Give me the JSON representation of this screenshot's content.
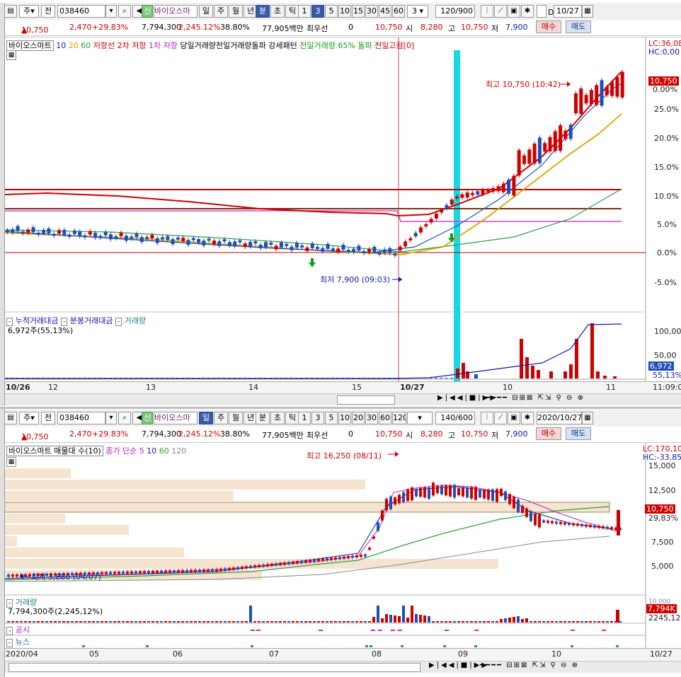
{
  "top": {
    "toolbar": {
      "type": "주",
      "range": "전",
      "code": "038460",
      "name": "바이오스마",
      "badge": "신",
      "periods": [
        "일",
        "주",
        "월",
        "년"
      ],
      "period_selected": "분",
      "periods2": [
        "분",
        "초",
        "틱"
      ],
      "nums": [
        "1",
        "3",
        "5",
        "10",
        "15",
        "30",
        "45",
        "60"
      ],
      "num_selected": "3",
      "custom": "3",
      "count": "120/900",
      "date": "10/27",
      "check_label": "D"
    },
    "info": {
      "price": "10,750",
      "change": "2,470",
      "pct": "+29.83%",
      "volume": "7,794,300",
      "vol_ratio": "2,245.12%",
      "ratio2": "38.80%",
      "amount": "77,905백만",
      "priority_label": "최우선",
      "priority_val": "0",
      "price2": "10,750",
      "open_label": "시",
      "open": "8,280",
      "high_label": "고",
      "high": "10,750",
      "low_label": "저",
      "low": "7,900",
      "buy": "매수",
      "sell": "매도"
    },
    "legend": {
      "name": "바이오스마트",
      "ma": [
        "10",
        "20",
        "60"
      ],
      "resist": "저항선",
      "r2": "2차 저항",
      "r1": "1차 저항",
      "breakout": "당일거래량전일거래량돌파",
      "pattern": "강세패턴",
      "prev_vol": "전일거래량",
      "prev_pct": "65% 돌파",
      "prev_high": "전일고점[0]"
    },
    "right_labels": {
      "lc": "LC:36,08",
      "hc": "HC:0,00"
    },
    "axis": [
      "0.00%",
      "25.0%",
      "20.0%",
      "15.0%",
      "10.0%",
      "5.0%",
      "0.0%",
      "-5.0%"
    ],
    "price_tag": "10,750",
    "high_note": "최고 10,750 (10:42)",
    "low_note": "최저 7,900 (09:03)",
    "vol_legend": {
      "cum": "누적거래대금",
      "per": "분봉거래대금",
      "vol": "거래량",
      "value": "6,972주(55,13%)"
    },
    "vol_axis": [
      "100,00",
      "50,00"
    ],
    "vol_tag": "6,972",
    "vol_tag2": "55,13%",
    "dates": [
      "10/26",
      "12",
      "13",
      "14",
      "15",
      "10/27",
      "10",
      "11"
    ],
    "time": "11:09:0"
  },
  "bottom": {
    "toolbar": {
      "type": "주",
      "range": "전",
      "code": "038460",
      "name": "바이오스마",
      "badge": "신",
      "periods": [
        "일",
        "주",
        "월",
        "년"
      ],
      "period_selected": "일",
      "periods2": [
        "분",
        "초",
        "틱"
      ],
      "nums": [
        "1",
        "3",
        "5",
        "10",
        "20",
        "30",
        "60",
        "120"
      ],
      "count": "140/600",
      "date": "2020/10/27"
    },
    "info": {
      "price": "10,750",
      "change": "2,470",
      "pct": "+29.83%",
      "volume": "7,794,300",
      "vol_ratio": "2,245.12%",
      "ratio2": "38.80%",
      "amount": "77,905백만",
      "priority_label": "최우선",
      "priority_val": "0",
      "price2": "10,750",
      "open_label": "시",
      "open": "8,280",
      "high_label": "고",
      "high": "10,750",
      "low_label": "저",
      "low": "7,900",
      "buy": "매수",
      "sell": "매도"
    },
    "legend": {
      "name": "바이오스마트 매물대 수(10)",
      "ma": "종가 단순 5",
      "ma_vals": [
        "10",
        "60",
        "120"
      ]
    },
    "right_labels": {
      "lc": "LC:170,10",
      "hc": "HC:-33,85"
    },
    "axis": [
      "15,000",
      "12,500",
      "7,500",
      "5,000"
    ],
    "price_tag": "10,750",
    "pct_tag": "29,83%",
    "high_note": "최고 16,250 (08/11)",
    "low_note": "최저 3,880 (04/07)",
    "vol_legend": {
      "vol": "거래량",
      "value": "7,794,300주(2,245,12%)"
    },
    "vol_tag": "7,794K",
    "vol_tag2": "2245,12%",
    "vol_axis": "10,000",
    "disclosure": "공시",
    "news": "뉴스",
    "dates": [
      "2020/04",
      "05",
      "06",
      "07",
      "08",
      "09",
      "10",
      "10/27"
    ]
  },
  "colors": {
    "up": "#d00000",
    "down": "#1e4fb8",
    "cyan": "#18d8e8",
    "ma5": "#d80000",
    "ma20": "#e0a000",
    "ma60": "#2aa040"
  }
}
